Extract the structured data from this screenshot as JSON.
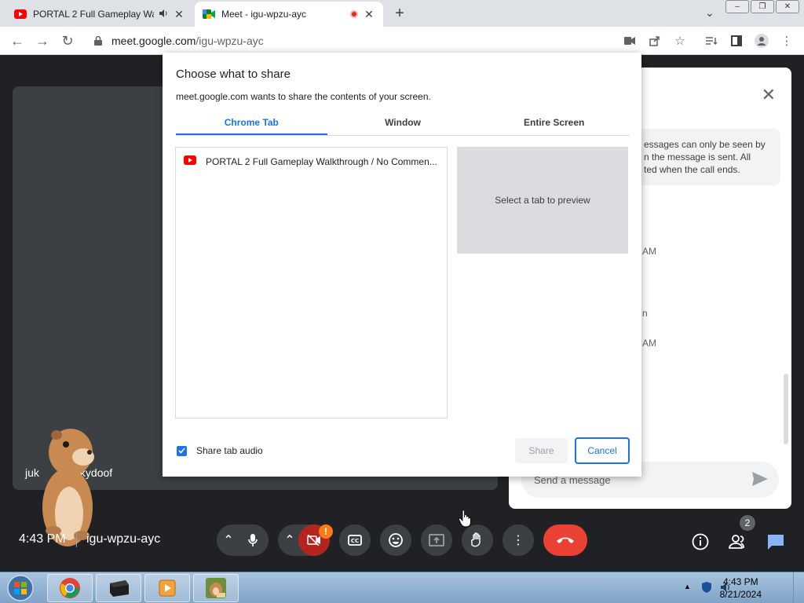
{
  "browser": {
    "tabs": [
      {
        "title": "PORTAL 2 Full Gameplay Wa",
        "favicon": "youtube-icon",
        "audio": "speaker-icon"
      },
      {
        "title": "Meet - igu-wpzu-ayc",
        "favicon": "meet-icon",
        "recording": "record-icon"
      }
    ],
    "url_host": "meet.google.com",
    "url_path": "/igu-wpzu-ayc"
  },
  "meet": {
    "participant_name_start": "juk",
    "participant_name_end": "kydoof",
    "chat_note_line1": "essages can only be seen by",
    "chat_note_line2": "n the message is sent. All",
    "chat_note_line3": "ted when the call ends.",
    "chat_meta": [
      "AM",
      "n",
      "AM"
    ],
    "chat_input_placeholder": "Send a message",
    "time": "4:43 PM",
    "code": "igu-wpzu-ayc",
    "camera_warning": "!",
    "participants_count": "2"
  },
  "dialog": {
    "title": "Choose what to share",
    "subtitle": "meet.google.com wants to share the contents of your screen.",
    "tabs": [
      "Chrome Tab",
      "Window",
      "Entire Screen"
    ],
    "selected_tab": "Chrome Tab",
    "tab_list": [
      "PORTAL 2 Full Gameplay Walkthrough / No Commen..."
    ],
    "preview_text": "Select a tab to preview",
    "share_audio_label": "Share tab audio",
    "share_audio_checked": true,
    "share_label": "Share",
    "cancel_label": "Cancel"
  },
  "taskbar": {
    "time": "4:43 PM",
    "date": "8/21/2024"
  },
  "colors": {
    "accent": "#1a73e8",
    "end_call": "#ea4335",
    "meet_bg": "#202124",
    "warning": "#fa7b17"
  }
}
